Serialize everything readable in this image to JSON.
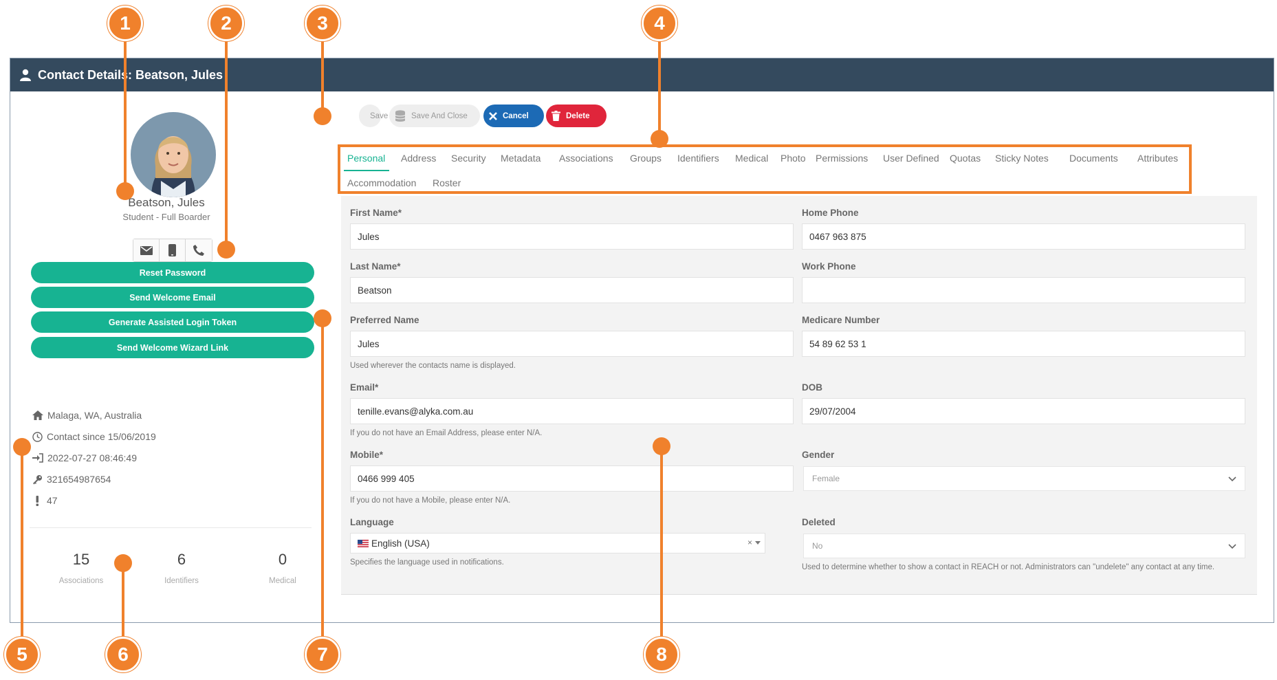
{
  "window": {
    "title": "Contact Details: Beatson, Jules"
  },
  "profile": {
    "name": "Beatson, Jules",
    "subtitle": "Student - Full Boarder"
  },
  "actions": {
    "reset_password": "Reset Password",
    "send_welcome_email": "Send Welcome Email",
    "generate_login_token": "Generate Assisted Login Token",
    "send_wizard_link": "Send Welcome Wizard Link"
  },
  "info": {
    "location": "Malaga, WA, Australia",
    "contact_since": "Contact since 15/06/2019",
    "last_login": "2022-07-27 08:46:49",
    "key": "321654987654",
    "alerts": "47"
  },
  "stats": [
    {
      "value": "15",
      "label": "Associations"
    },
    {
      "value": "6",
      "label": "Identifiers"
    },
    {
      "value": "0",
      "label": "Medical"
    }
  ],
  "toolbar": {
    "save": "Save",
    "save_and_close": "Save And Close",
    "cancel": "Cancel",
    "delete": "Delete"
  },
  "tabs": [
    "Personal",
    "Address",
    "Security",
    "Metadata",
    "Associations",
    "Groups",
    "Identifiers",
    "Medical",
    "Photo",
    "Permissions",
    "User Defined",
    "Quotas",
    "Sticky Notes",
    "Documents",
    "Attributes",
    "Accommodation",
    "Roster"
  ],
  "form": {
    "first_name": {
      "label": "First Name*",
      "value": "Jules"
    },
    "last_name": {
      "label": "Last Name*",
      "value": "Beatson"
    },
    "preferred_name": {
      "label": "Preferred Name",
      "value": "Jules",
      "help": "Used wherever the contacts name is displayed."
    },
    "email": {
      "label": "Email*",
      "value": "tenille.evans@alyka.com.au",
      "help": "If you do not have an Email Address, please enter N/A."
    },
    "mobile": {
      "label": "Mobile*",
      "value": "0466 999 405",
      "help": "If you do not have a Mobile, please enter N/A."
    },
    "language": {
      "label": "Language",
      "value": "English (USA)",
      "help": "Specifies the language used in notifications.",
      "clear": "×"
    },
    "home_phone": {
      "label": "Home Phone",
      "value": "0467 963 875"
    },
    "work_phone": {
      "label": "Work Phone",
      "value": ""
    },
    "medicare": {
      "label": "Medicare Number",
      "value": "54 89 62 53 1"
    },
    "dob": {
      "label": "DOB",
      "value": "29/07/2004"
    },
    "gender": {
      "label": "Gender",
      "value": "Female"
    },
    "deleted": {
      "label": "Deleted",
      "value": "No",
      "help": "Used to determine whether to show a contact in REACH or not. Administrators can \"undelete\" any contact at any time."
    }
  },
  "callouts": [
    "1",
    "2",
    "3",
    "4",
    "5",
    "6",
    "7",
    "8"
  ],
  "colors": {
    "header": "#344a5e",
    "accent": "#17b392",
    "callout": "#f0812c",
    "cancel": "#1c6ab5",
    "delete": "#e0253b"
  }
}
